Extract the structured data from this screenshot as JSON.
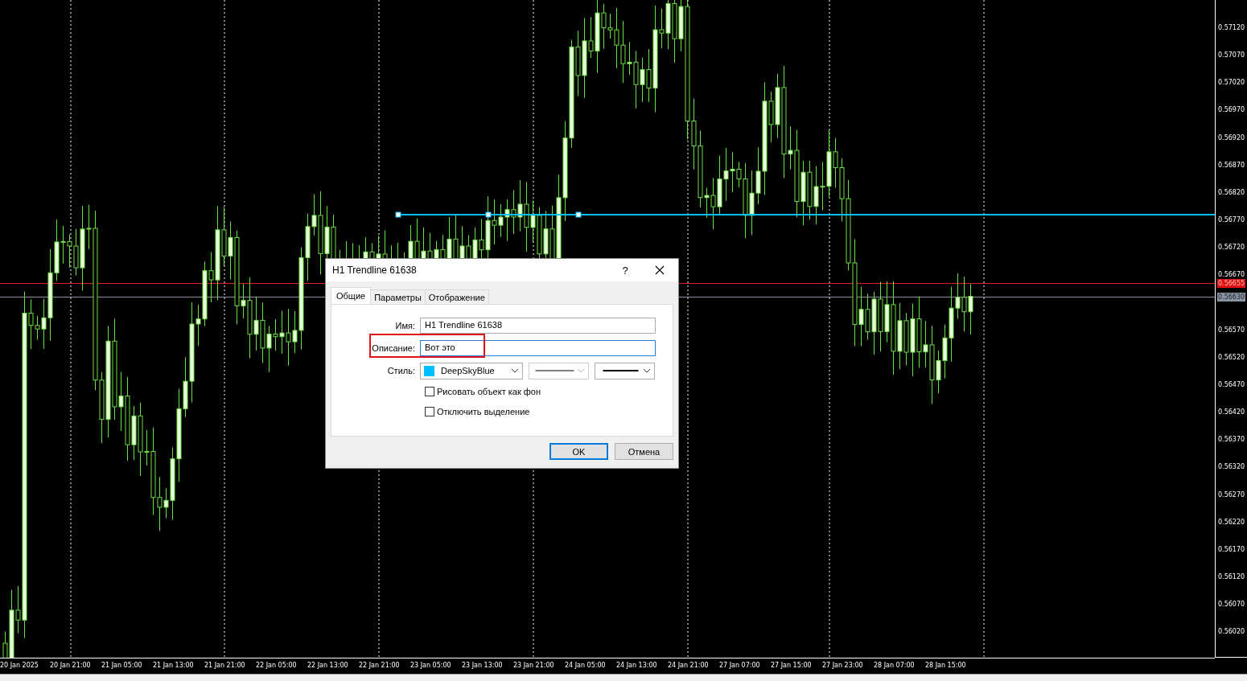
{
  "chart": {
    "price_axis": [
      "0.57120",
      "0.57070",
      "0.57020",
      "0.56970",
      "0.56920",
      "0.56870",
      "0.56820",
      "0.56770",
      "0.56720",
      "0.56670",
      "0.56570",
      "0.56520",
      "0.56470",
      "0.56420",
      "0.56370",
      "0.56320",
      "0.56270",
      "0.56220",
      "0.56170",
      "0.56120",
      "0.56070",
      "0.56020"
    ],
    "time_axis": [
      "20 Jan 2025",
      "20 Jan 21:00",
      "21 Jan 05:00",
      "21 Jan 13:00",
      "21 Jan 21:00",
      "22 Jan 05:00",
      "22 Jan 13:00",
      "22 Jan 21:00",
      "23 Jan 05:00",
      "23 Jan 13:00",
      "23 Jan 21:00",
      "24 Jan 05:00",
      "24 Jan 13:00",
      "24 Jan 21:00",
      "27 Jan 07:00",
      "27 Jan 15:00",
      "27 Jan 23:00",
      "28 Jan 07:00",
      "28 Jan 15:00"
    ],
    "bid_label": "0.56655",
    "ask_label": "0.56630",
    "trendline": {
      "color": "#00bfff",
      "selected": true
    }
  },
  "dialog": {
    "title": "H1 Trendline 61638",
    "help": "?",
    "tabs": [
      {
        "label": "Общие",
        "selected": true
      },
      {
        "label": "Параметры",
        "selected": false
      },
      {
        "label": "Отображение",
        "selected": false
      }
    ],
    "fields": [
      {
        "label": "Имя:",
        "value": "H1 Trendline 61638",
        "focused": false,
        "highlighted": false
      },
      {
        "label": "Описание:",
        "value": "Вот это",
        "focused": true,
        "highlighted": true
      }
    ],
    "style": {
      "label": "Стиль:",
      "color_name": "DeepSkyBlue",
      "color": "#00bfff",
      "line_style_disabled": true
    },
    "checkboxes": [
      {
        "label": "Рисовать объект как фон",
        "checked": false
      },
      {
        "label": "Отключить выделение",
        "checked": false
      }
    ],
    "buttons": [
      {
        "label": "OK",
        "default": true
      },
      {
        "label": "Отмена",
        "default": false
      }
    ]
  }
}
